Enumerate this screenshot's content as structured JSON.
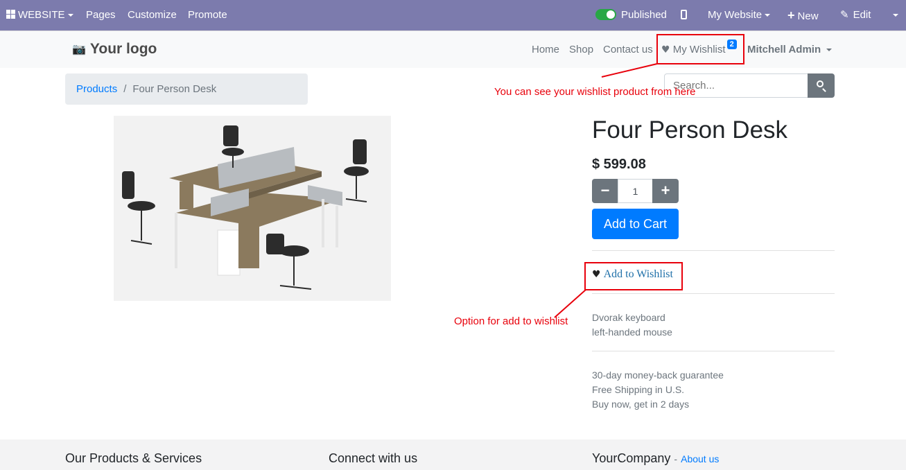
{
  "adminbar": {
    "website_label": "WEBSITE",
    "pages_label": "Pages",
    "customize_label": "Customize",
    "promote_label": "Promote",
    "published_label": "Published",
    "my_website_label": "My Website",
    "new_label": "New",
    "edit_label": "Edit",
    "bg_color": "#7c7bad"
  },
  "header": {
    "logo_text": "Your logo",
    "nav": {
      "home": "Home",
      "shop": "Shop",
      "contact": "Contact us",
      "wishlist": "My Wishlist",
      "wishlist_count": "2",
      "user": "Mitchell Admin"
    }
  },
  "breadcrumb": {
    "root": "Products",
    "separator": "/",
    "current": "Four Person Desk"
  },
  "search": {
    "placeholder": "Search..."
  },
  "product": {
    "name": "Four Person Desk",
    "price": "$ 599.08",
    "quantity": "1",
    "add_to_cart": "Add to Cart",
    "add_to_wishlist": "Add to Wishlist",
    "description": [
      "Dvorak keyboard",
      "left-handed mouse"
    ],
    "terms": [
      "30-day money-back guarantee",
      "Free Shipping in U.S.",
      "Buy now, get in 2 days"
    ]
  },
  "annotations": {
    "wishlist_nav_note": "You can see your wishlist product from here",
    "add_wishlist_note": "Option for add to wishlist",
    "color": "#e8000b"
  },
  "footer": {
    "col1_title": "Our Products & Services",
    "col2_title": "Connect with us",
    "col3_title": "YourCompany",
    "col3_sep": "-",
    "col3_link": "About us"
  }
}
